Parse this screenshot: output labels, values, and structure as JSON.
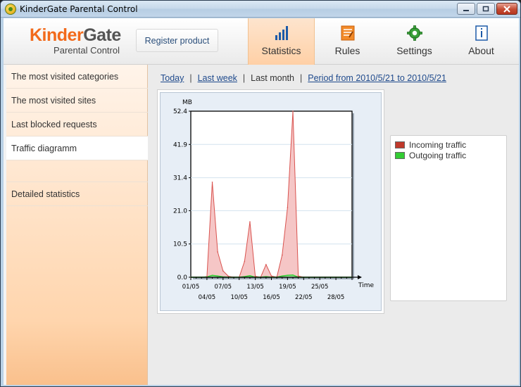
{
  "window": {
    "title": "KinderGate Parental Control"
  },
  "header": {
    "logo_part1": "Kinder",
    "logo_part2": "Gate",
    "logo_subtitle": "Parental Control",
    "register_label": "Register product",
    "tabs": [
      {
        "label": "Statistics",
        "icon": "bar-chart-icon",
        "active": true
      },
      {
        "label": "Rules",
        "icon": "rules-document-icon",
        "active": false
      },
      {
        "label": "Settings",
        "icon": "gear-icon",
        "active": false
      },
      {
        "label": "About",
        "icon": "info-icon",
        "active": false
      }
    ]
  },
  "sidebar": {
    "items": [
      {
        "label": "The most visited categories"
      },
      {
        "label": "The most visited sites"
      },
      {
        "label": "Last blocked requests"
      },
      {
        "label": "Traffic diagramm",
        "active": true
      },
      {
        "label": "Detailed statistics"
      }
    ]
  },
  "periods": {
    "today": "Today",
    "last_week": "Last week",
    "last_month": "Last month",
    "range": "Period from 2010/5/21 to 2010/5/21"
  },
  "legend": [
    {
      "label": "Incoming traffic",
      "color": "#c0392b"
    },
    {
      "label": "Outgoing traffic",
      "color": "#33cc33"
    }
  ],
  "colors": {
    "accent_orange": "#f26a1b",
    "incoming_fill": "#f5c6c6",
    "incoming_line": "#d9534f",
    "outgoing": "#33cc33"
  },
  "chart_data": {
    "type": "area",
    "ylabel": "MB",
    "xlabel": "Time",
    "y_ticks": [
      "52.4",
      "41.9",
      "31.4",
      "21.0",
      "10.5",
      "0.0"
    ],
    "ylim": [
      0,
      52.4
    ],
    "x_ticks_upper": [
      "01/05",
      "07/05",
      "13/05",
      "19/05",
      "25/05"
    ],
    "x_ticks_lower": [
      "04/05",
      "10/05",
      "16/05",
      "22/05",
      "28/05"
    ],
    "x_tick_days_upper": [
      1,
      7,
      13,
      19,
      25
    ],
    "x_tick_days_lower": [
      4,
      10,
      16,
      22,
      28
    ],
    "xlim": [
      1,
      31
    ],
    "grid": true,
    "legend_position": "right",
    "series": [
      {
        "name": "Incoming traffic",
        "x": [
          1,
          2,
          3,
          4,
          5,
          6,
          7,
          8,
          9,
          10,
          11,
          12,
          13,
          14,
          15,
          16,
          17,
          18,
          19,
          20,
          21,
          22,
          23,
          24,
          25,
          26,
          27,
          28,
          29,
          30,
          31
        ],
        "values": [
          0,
          0,
          0,
          0.2,
          30,
          8,
          2,
          0.3,
          0,
          0,
          5,
          17.5,
          0.3,
          0,
          4,
          0.4,
          0,
          7,
          22,
          52.4,
          0.4,
          0,
          0,
          0,
          0,
          0,
          0,
          0,
          0,
          0,
          0
        ]
      },
      {
        "name": "Outgoing traffic",
        "x": [
          1,
          2,
          3,
          4,
          5,
          6,
          7,
          8,
          9,
          10,
          11,
          12,
          13,
          14,
          15,
          16,
          17,
          18,
          19,
          20,
          21,
          22,
          23,
          24,
          25,
          26,
          27,
          28,
          29,
          30,
          31
        ],
        "values": [
          0,
          0,
          0,
          0.1,
          0.6,
          0.4,
          0.1,
          0,
          0,
          0,
          0.2,
          0.5,
          0,
          0,
          0.2,
          0,
          0,
          0.4,
          0.6,
          0.7,
          0,
          0,
          0,
          0,
          0,
          0,
          0,
          0,
          0,
          0,
          0
        ]
      }
    ]
  }
}
